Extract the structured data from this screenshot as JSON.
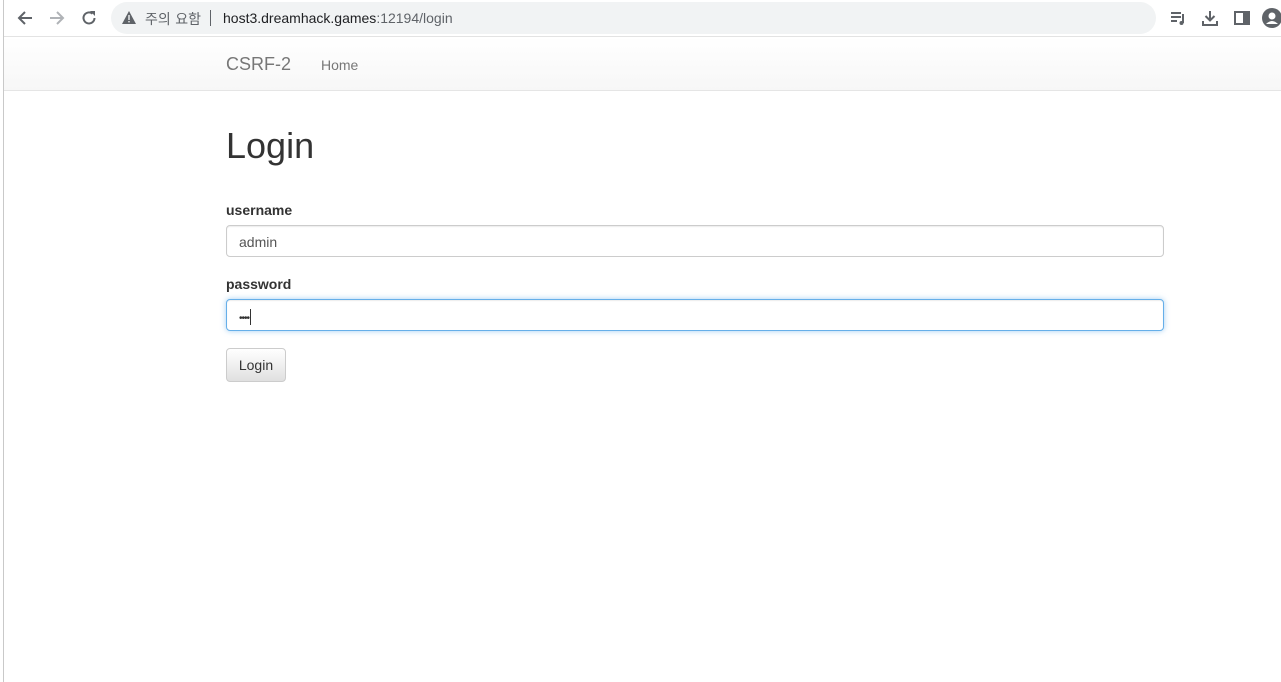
{
  "browser": {
    "security_label": "주의 요함",
    "url_host": "host3.dreamhack.games",
    "url_path": ":12194/login"
  },
  "navbar": {
    "brand": "CSRF-2",
    "home": "Home"
  },
  "page": {
    "title": "Login",
    "username_label": "username",
    "username_value": "admin",
    "password_label": "password",
    "password_value_masked": "••••",
    "login_button": "Login"
  }
}
